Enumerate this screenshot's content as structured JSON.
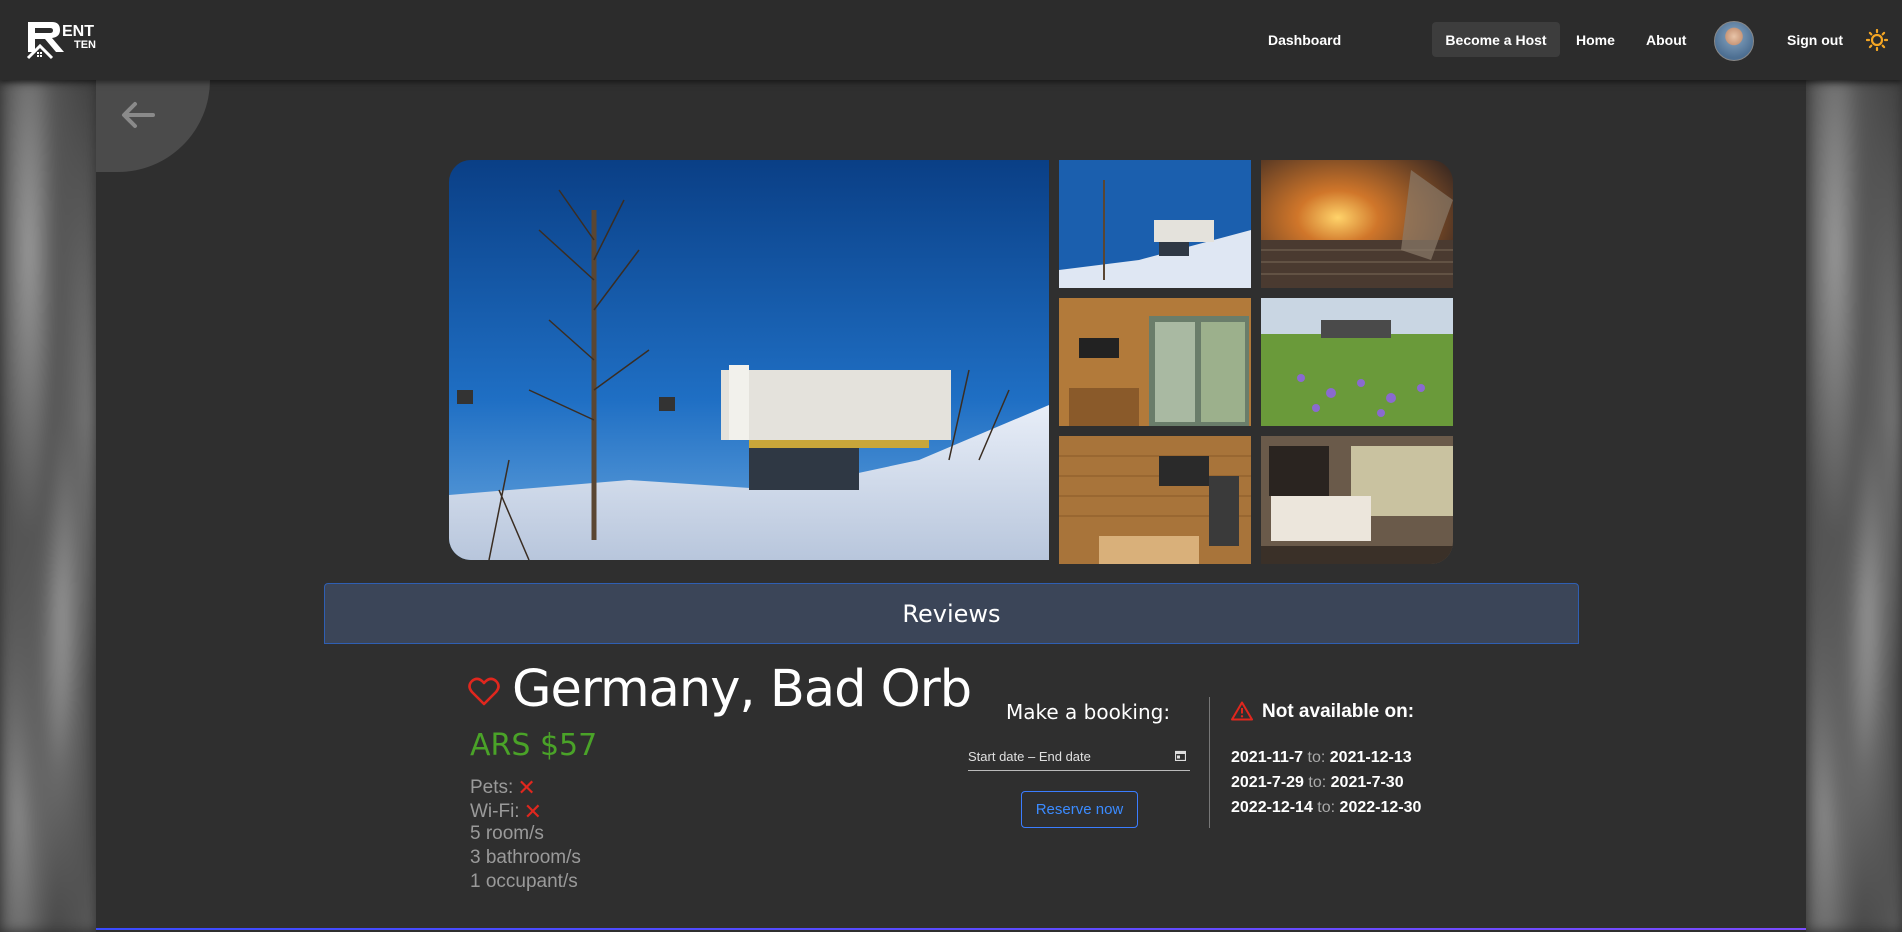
{
  "nav": {
    "dashboard": "Dashboard",
    "become_host": "Become a Host",
    "home": "Home",
    "about": "About",
    "sign_out": "Sign out"
  },
  "logo": {
    "text_top": "ENT",
    "text_bottom": "TEN"
  },
  "reviews_label": "Reviews",
  "listing": {
    "title": "Germany, Bad Orb",
    "price": "ARS $57",
    "pets_label": "Pets:",
    "wifi_label": "Wi-Fi:",
    "rooms": "5 room/s",
    "bathrooms": "3 bathroom/s",
    "occupants": "1 occupant/s"
  },
  "booking": {
    "title": "Make a booking:",
    "date_placeholder": "Start date – End date",
    "reserve_label": "Reserve now"
  },
  "unavailable": {
    "title": "Not available on:",
    "to_word": "to:",
    "ranges": [
      {
        "start": "2021-11-7",
        "end": "2021-12-13"
      },
      {
        "start": "2021-7-29",
        "end": "2021-7-30"
      },
      {
        "start": "2022-12-14",
        "end": "2022-12-30"
      }
    ]
  },
  "colors": {
    "price_green": "#4aa328",
    "accent_blue": "#3b8bff",
    "danger_red": "#e0271e",
    "theme_sun": "#f5a623"
  }
}
